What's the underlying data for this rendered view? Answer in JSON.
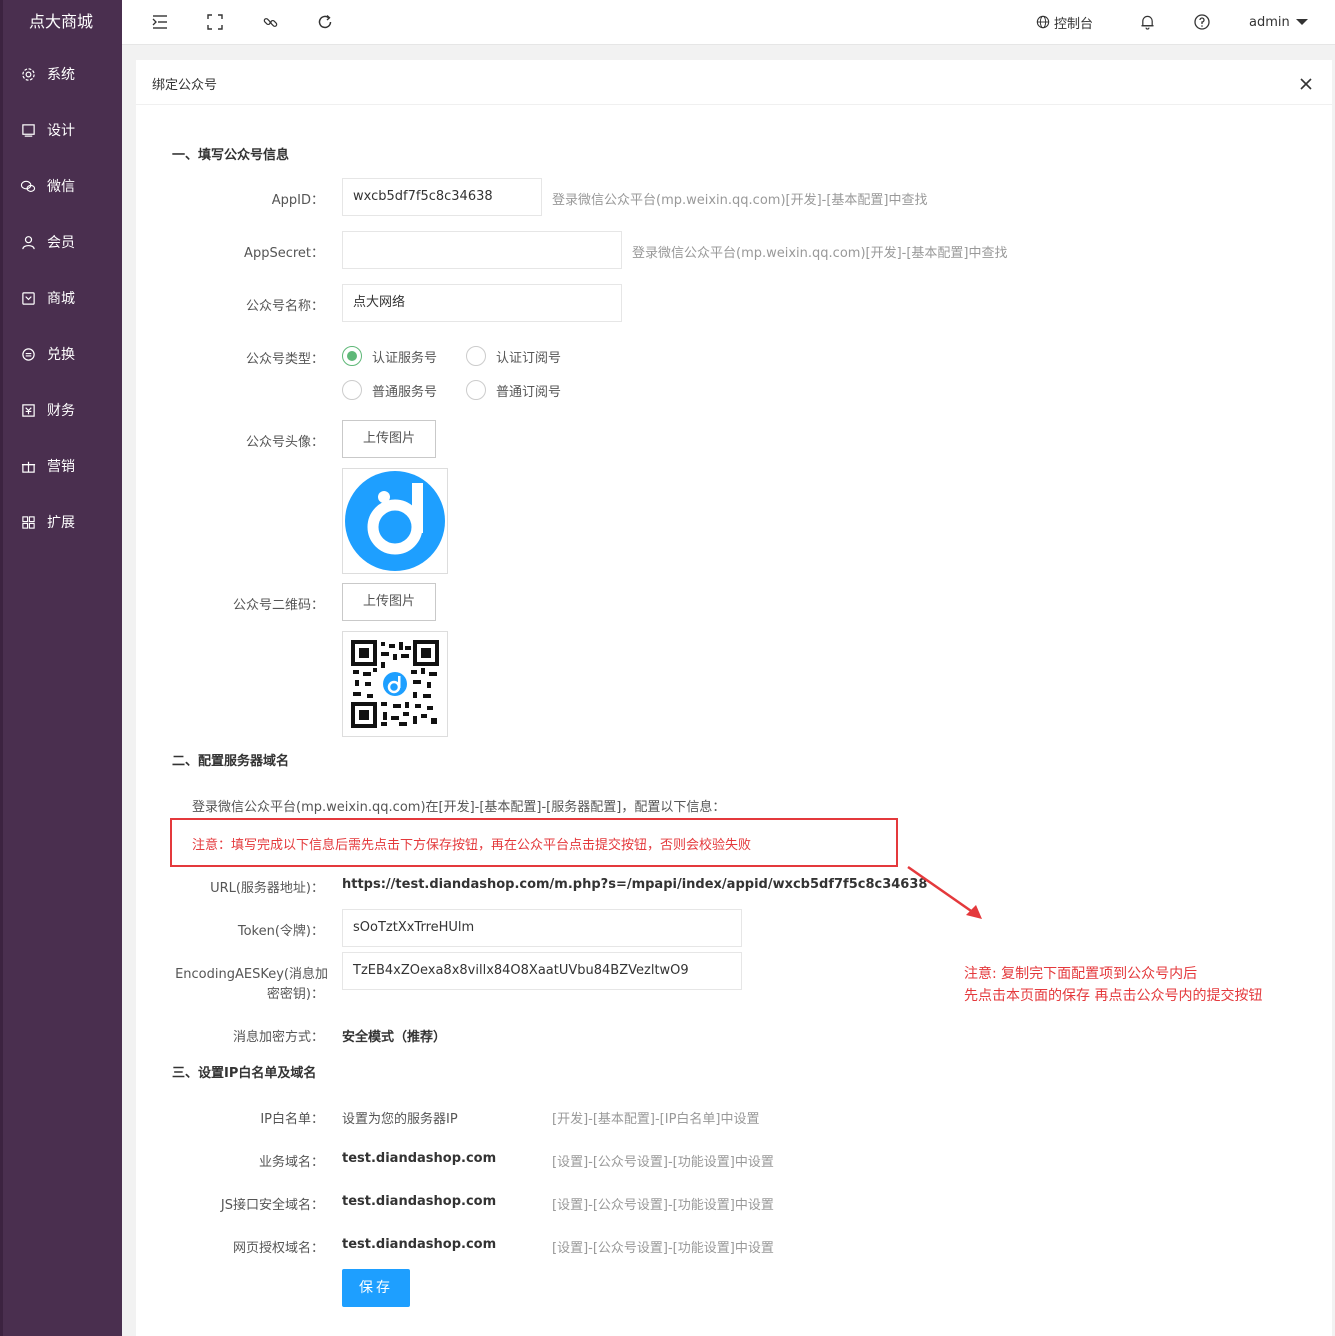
{
  "app": {
    "logo": "点大商城"
  },
  "sidebar": {
    "items": [
      {
        "label": "系统",
        "icon": "gear-icon"
      },
      {
        "label": "设计",
        "icon": "monitor-icon"
      },
      {
        "label": "微信",
        "icon": "wechat-icon"
      },
      {
        "label": "会员",
        "icon": "user-icon"
      },
      {
        "label": "商城",
        "icon": "shop-icon"
      },
      {
        "label": "兑换",
        "icon": "exchange-icon"
      },
      {
        "label": "财务",
        "icon": "finance-icon"
      },
      {
        "label": "营销",
        "icon": "gift-icon"
      },
      {
        "label": "扩展",
        "icon": "grid-icon"
      }
    ]
  },
  "header": {
    "console": "控制台",
    "user": "admin"
  },
  "panel": {
    "title": "绑定公众号"
  },
  "section1": {
    "title": "一、填写公众号信息",
    "appid": {
      "label": "AppID：",
      "value": "wxcb5df7f5c8c34638",
      "hint": "登录微信公众平台(mp.weixin.qq.com)[开发]-[基本配置]中查找"
    },
    "appsecret": {
      "label": "AppSecret：",
      "value": "",
      "hint": "登录微信公众平台(mp.weixin.qq.com)[开发]-[基本配置]中查找"
    },
    "name": {
      "label": "公众号名称：",
      "value": "点大网络"
    },
    "type": {
      "label": "公众号类型：",
      "options": [
        "认证服务号",
        "认证订阅号",
        "普通服务号",
        "普通订阅号"
      ],
      "selected": "认证服务号"
    },
    "avatar": {
      "label": "公众号头像：",
      "button": "上传图片"
    },
    "qrcode": {
      "label": "公众号二维码：",
      "button": "上传图片"
    }
  },
  "section2": {
    "title": "二、配置服务器域名",
    "intro": "登录微信公众平台(mp.weixin.qq.com)在[开发]-[基本配置]-[服务器配置]，配置以下信息：",
    "warning": "注意：填写完成以下信息后需先点击下方保存按钮，再在公众平台点击提交按钮，否则会校验失败",
    "url": {
      "label": "URL(服务器地址)：",
      "value": "https://test.diandashop.com/m.php?s=/mpapi/index/appid/wxcb5df7f5c8c34638"
    },
    "token": {
      "label": "Token(令牌)：",
      "value": "sOoTztXxTrreHUlm"
    },
    "aeskey": {
      "label_line1": "EncodingAESKey(消息加",
      "label_line2": "密密钥)：",
      "value": "TzEB4xZOexa8x8villx84O8XaatUVbu84BZVezltwO9"
    },
    "encrypt": {
      "label": "消息加密方式：",
      "value": "安全模式（推荐）"
    }
  },
  "annotation": {
    "line1": "注意: 复制完下面配置项到公众号内后",
    "line2": "先点击本页面的保存 再点击公众号内的提交按钮"
  },
  "section3": {
    "title": "三、设置IP白名单及域名",
    "rows": [
      {
        "label": "IP白名单：",
        "value": "设置为您的服务器IP",
        "hint": "[开发]-[基本配置]-[IP白名单]中设置"
      },
      {
        "label": "业务域名：",
        "value": "test.diandashop.com",
        "hint": "[设置]-[公众号设置]-[功能设置]中设置"
      },
      {
        "label": "JS接口安全域名：",
        "value": "test.diandashop.com",
        "hint": "[设置]-[公众号设置]-[功能设置]中设置"
      },
      {
        "label": "网页授权域名：",
        "value": "test.diandashop.com",
        "hint": "[设置]-[公众号设置]-[功能设置]中设置"
      }
    ]
  },
  "save_label": "保存",
  "colors": {
    "sidebar": "#4a2f4f",
    "accent": "#1e9fff",
    "radio": "#5fb878",
    "warning": "#e4393c"
  }
}
